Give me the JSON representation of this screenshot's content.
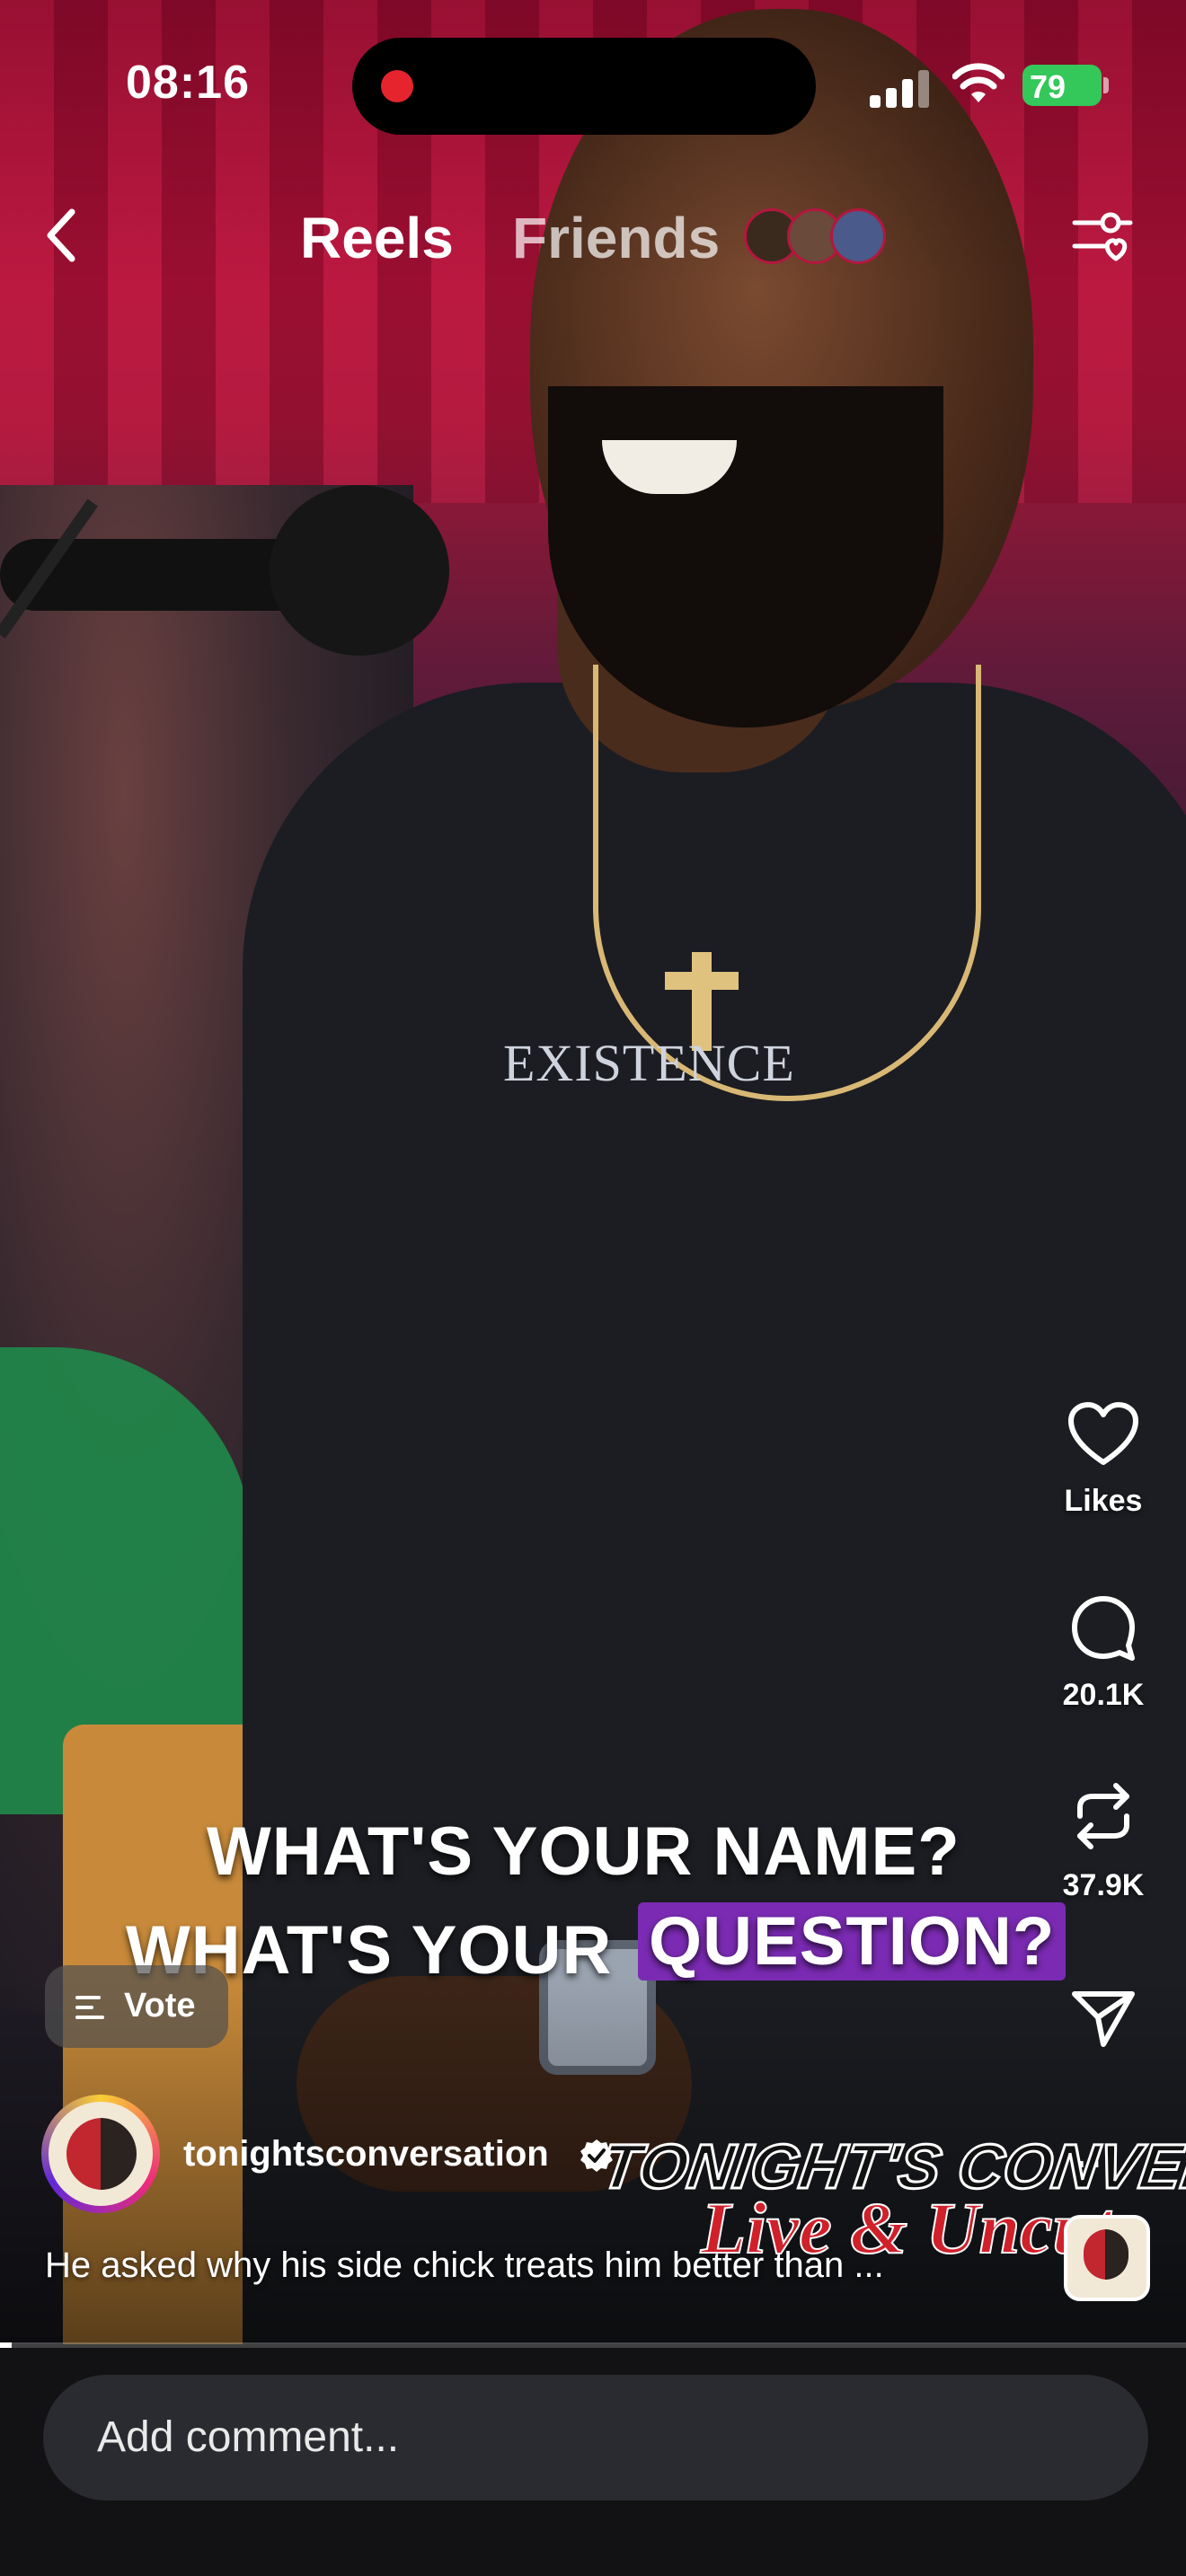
{
  "status_bar": {
    "time": "08:16",
    "battery": "79"
  },
  "header": {
    "tab_active": "Reels",
    "tab_inactive": "Friends"
  },
  "video": {
    "caption_line1": "WHAT'S YOUR NAME?",
    "caption_line2_a": "WHAT'S YOUR",
    "caption_line2_b": "QUESTION?",
    "shirt_text": "EXISTENCE",
    "logo_line1": "TONIGHT'S CONVERSATION",
    "logo_line2": "Live & Uncut"
  },
  "actions": {
    "likes_label": "Likes",
    "comments_count": "20.1K",
    "reposts_count": "37.9K"
  },
  "vote": {
    "label": "Vote"
  },
  "creator": {
    "username": "tonightsconversation",
    "caption": "He asked why his side chick treats him better than ..."
  },
  "more_label": "...",
  "progress": {
    "fraction": 0.01
  },
  "comment": {
    "placeholder": "Add comment..."
  },
  "colors": {
    "caption_highlight": "#7b2bb3",
    "battery": "#34c759",
    "recording_dot": "#e5242e"
  }
}
